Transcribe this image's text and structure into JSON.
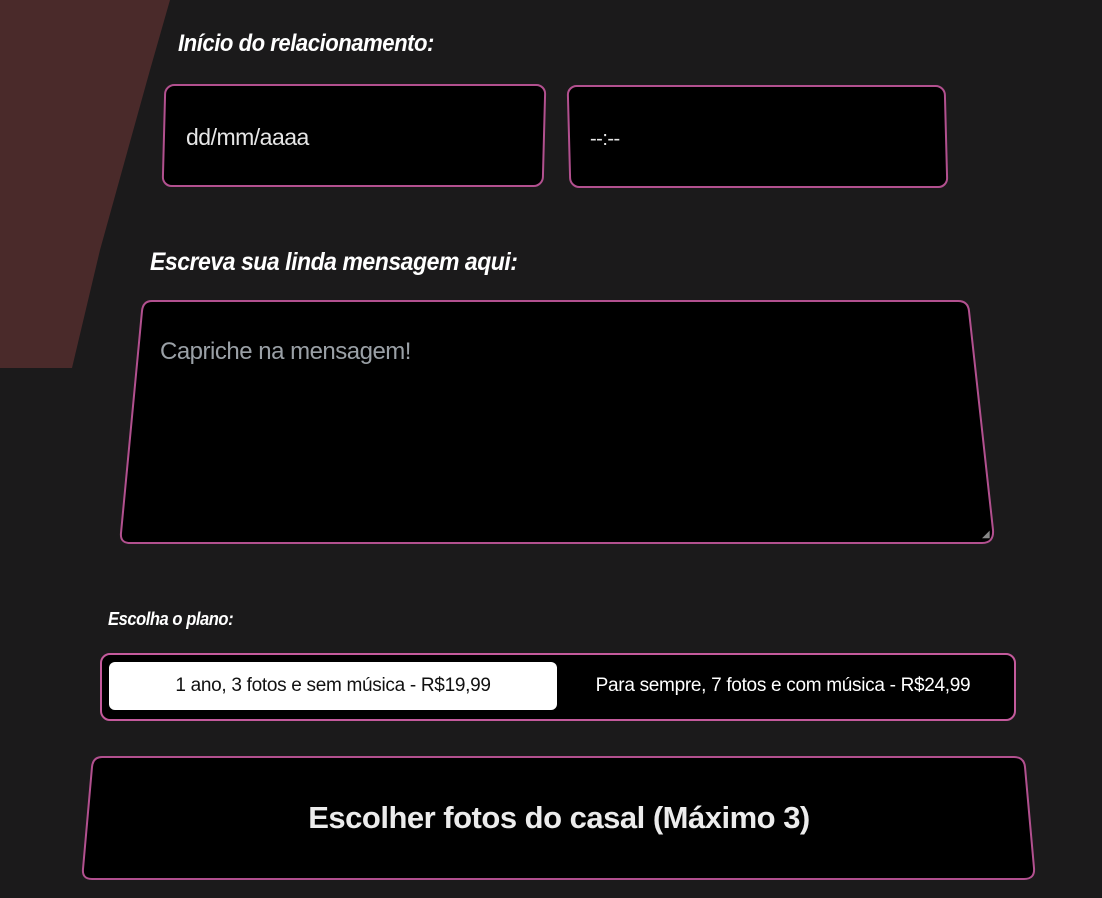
{
  "form": {
    "start_label": "Início do relacionamento:",
    "date_placeholder": "dd/mm/aaaa",
    "time_placeholder": "--:--",
    "message_label": "Escreva sua linda mensagem aqui:",
    "message_placeholder": "Capriche na mensagem!",
    "plan_label": "Escolha o plano:",
    "plans": [
      {
        "label": "1 ano, 3 fotos e sem música - R$19,99",
        "selected": true
      },
      {
        "label": "Para sempre, 7 fotos e com música - R$24,99",
        "selected": false
      }
    ],
    "photos_button": "Escolher fotos do casal (Máximo 3)"
  },
  "colors": {
    "background": "#1b1a1b",
    "accent_border": "#b2508f",
    "field_bg": "#000000",
    "decor_shape": "#4a2a2a",
    "selected_plan_bg": "#ffffff"
  }
}
